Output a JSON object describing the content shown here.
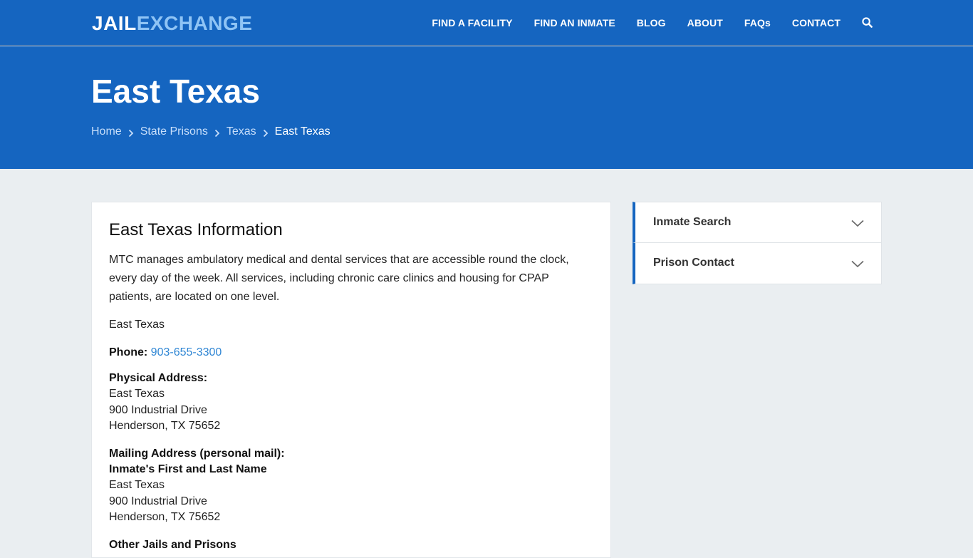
{
  "brand": {
    "part1": "JAIL",
    "part2": "EXCHANGE"
  },
  "nav": {
    "items": [
      "FIND A FACILITY",
      "FIND AN INMATE",
      "BLOG",
      "ABOUT",
      "FAQs",
      "CONTACT"
    ],
    "search_icon": "search-icon"
  },
  "hero": {
    "title": "East Texas",
    "breadcrumb": [
      "Home",
      "State Prisons",
      "Texas",
      "East Texas"
    ]
  },
  "main": {
    "heading": "East Texas Information",
    "description": "MTC manages ambulatory medical and dental services that are accessible round the clock, every day of the week. All services, including chronic care clinics and housing for CPAP patients, are located on one level.",
    "facility_name": "East Texas",
    "phone_label": "Phone:",
    "phone": "903-655-3300",
    "physical": {
      "label": "Physical Address:",
      "lines": [
        "East Texas",
        "900 Industrial Drive",
        "Henderson, TX 75652"
      ]
    },
    "mailing": {
      "label": "Mailing Address (personal mail):",
      "name_line": "Inmate's First and Last Name",
      "lines": [
        "East Texas",
        "900 Industrial Drive",
        "Henderson, TX 75652"
      ]
    },
    "other_label": "Other Jails and Prisons"
  },
  "sidebar": {
    "items": [
      {
        "label": "Inmate Search"
      },
      {
        "label": "Prison Contact"
      }
    ]
  },
  "colors": {
    "primary": "#1565c0",
    "link": "#2f86d4",
    "background": "#eaeef1"
  }
}
